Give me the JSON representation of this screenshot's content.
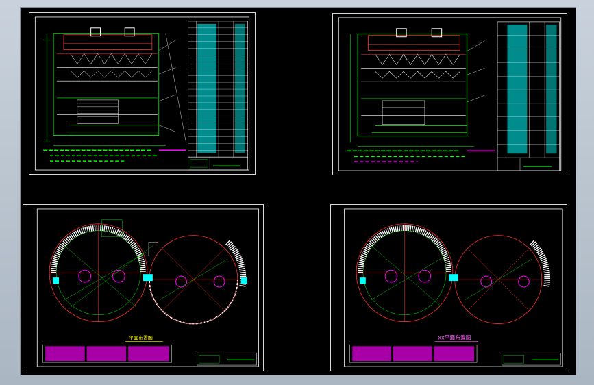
{
  "app": {
    "window_title": ""
  },
  "colors": {
    "background": "#000000",
    "border": "#d8d8d8",
    "cad_green": "#00ff00",
    "cad_cyan": "#00ffff",
    "cad_magenta": "#ff00ff",
    "cad_red": "#ff3030",
    "cad_white": "#ffffff",
    "cad_yellow": "#ffff00"
  },
  "sheets": [
    {
      "id": "elevation-1",
      "kind": "elevation"
    },
    {
      "id": "elevation-2",
      "kind": "elevation"
    },
    {
      "id": "plan-1",
      "kind": "plan",
      "plan_title": "平面布置图"
    },
    {
      "id": "plan-2",
      "kind": "plan",
      "plan_title": "xx平面布置图"
    }
  ]
}
